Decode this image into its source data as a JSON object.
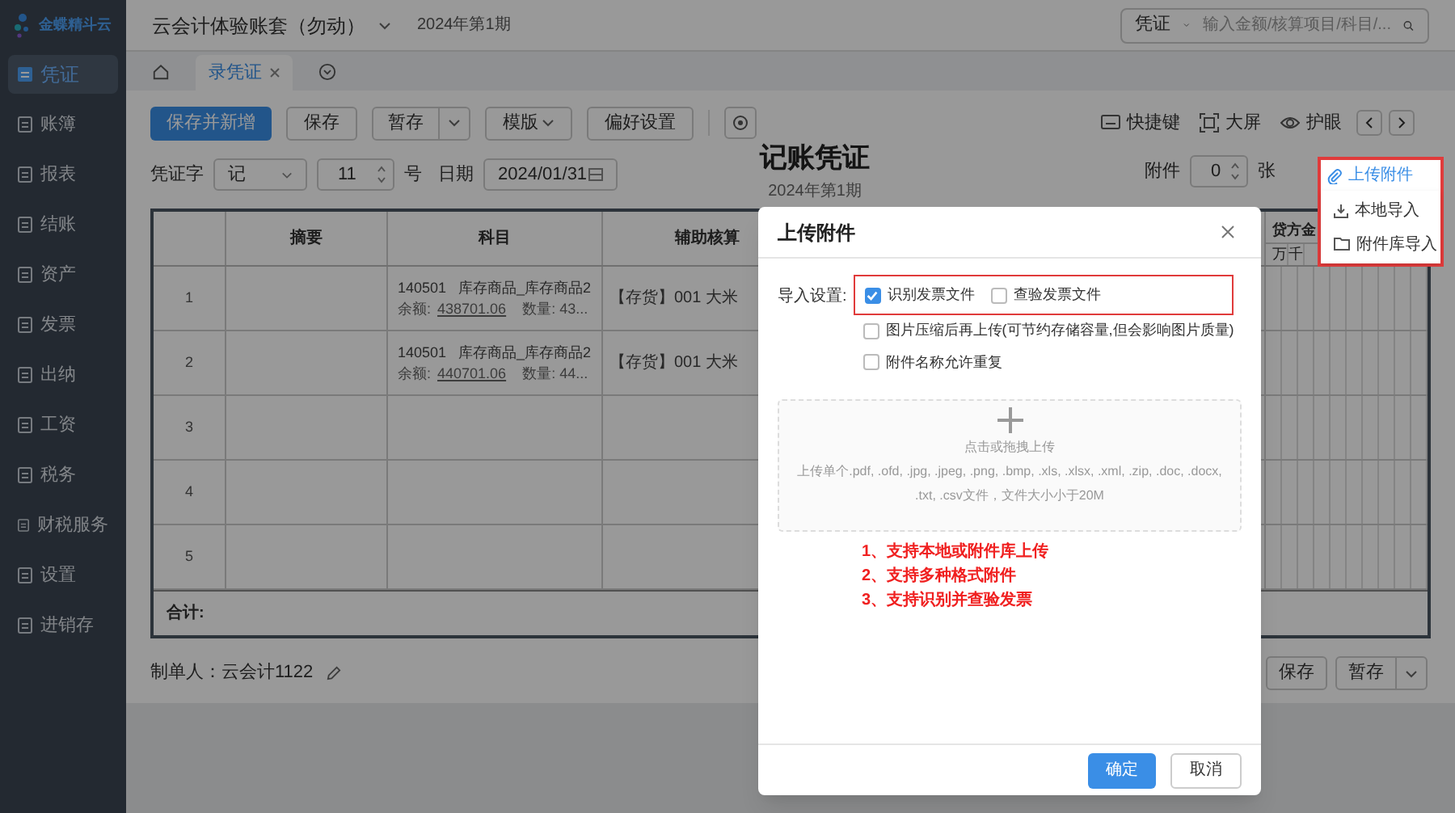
{
  "logo": {
    "text": "金蝶精斗云"
  },
  "sidebar": {
    "items": [
      {
        "label": "凭证",
        "selected": true
      },
      {
        "label": "账簿",
        "selected": false
      },
      {
        "label": "报表",
        "selected": false
      },
      {
        "label": "结账",
        "selected": false
      },
      {
        "label": "资产",
        "selected": false
      },
      {
        "label": "发票",
        "selected": false
      },
      {
        "label": "出纳",
        "selected": false
      },
      {
        "label": "工资",
        "selected": false
      },
      {
        "label": "税务",
        "selected": false
      },
      {
        "label": "财税服务",
        "selected": false
      },
      {
        "label": "设置",
        "selected": false
      },
      {
        "label": "进销存",
        "selected": false
      }
    ]
  },
  "topbar": {
    "account": "云会计体验账套（勿动）",
    "period": "2024年第1期",
    "search_scope": "凭证",
    "search": {
      "placeholder": "输入金额/核算项目/科目/..."
    }
  },
  "tabs": [
    {
      "label": "录凭证",
      "selected": true
    }
  ],
  "toolbar": {
    "buttons": [
      {
        "label": "保存并新增",
        "kind": "primary"
      },
      {
        "label": "保存",
        "kind": "plain"
      },
      {
        "label": "暂存",
        "kind": "split"
      },
      {
        "label": "模版",
        "kind": "dropdown"
      },
      {
        "label": "偏好设置",
        "kind": "plain"
      }
    ],
    "tools": [
      {
        "label": "快捷键",
        "kind": "keyboard"
      },
      {
        "label": "大屏",
        "kind": "fullscreen"
      },
      {
        "label": "护眼",
        "kind": "eye"
      }
    ]
  },
  "voucher": {
    "word_label": "凭证字",
    "word": "记",
    "number": "11",
    "number_suffix": "号",
    "date_label": "日期",
    "date": "2024/01/31",
    "title": "记账凭证",
    "period": "2024年第1期",
    "attach_label": "附件",
    "attach_count": "0",
    "attach_unit": "张"
  },
  "upload_menu": {
    "trigger": "上传附件",
    "items": [
      "本地导入",
      "附件库导入"
    ]
  },
  "table": {
    "columns": [
      "摘要",
      "科目",
      "辅助核算"
    ],
    "credit_header": "贷方金",
    "digit_headers": [
      "万",
      "千"
    ],
    "rows": [
      {
        "index": "1",
        "account": "140501   库存商品_库存商品2",
        "balance_label": "余额:",
        "balance": "438701.06",
        "qty": "数量: 43...",
        "aux": "【存货】001 大米"
      },
      {
        "index": "2",
        "account": "140501   库存商品_库存商品2",
        "balance_label": "余额:",
        "balance": "440701.06",
        "qty": "数量: 44...",
        "aux": "【存货】001 大米"
      },
      {
        "index": "3"
      },
      {
        "index": "4"
      },
      {
        "index": "5"
      }
    ],
    "total_label": "合计:"
  },
  "footer": {
    "maker": "制单人：云会计1122",
    "buttons": [
      {
        "label": "保存",
        "kind": "plain"
      },
      {
        "label": "暂存",
        "kind": "split"
      }
    ]
  },
  "dialog": {
    "title": "上传附件",
    "settings_label": "导入设置:",
    "options": [
      {
        "label": "识别发票文件",
        "checked": true,
        "highlighted": true
      },
      {
        "label": "查验发票文件",
        "checked": false,
        "highlighted": true
      },
      {
        "label": "图片压缩后再上传(可节约存储容量,但会影响图片质量)",
        "checked": false,
        "highlighted": false
      },
      {
        "label": "附件名称允许重复",
        "checked": false,
        "highlighted": false
      }
    ],
    "upload": {
      "hint": "点击或拖拽上传",
      "desc": "上传单个.pdf, .ofd, .jpg, .jpeg, .png, .bmp, .xls, .xlsx, .xml, .zip, .doc, .docx, .txt, .csv文件，文件大小小于20M"
    },
    "notes": [
      "1、支持本地或附件库上传",
      "2、支持多种格式附件",
      "3、支持识别并查验发票"
    ],
    "buttons": [
      {
        "label": "确定",
        "kind": "primary"
      },
      {
        "label": "取消",
        "kind": "plain"
      }
    ]
  }
}
